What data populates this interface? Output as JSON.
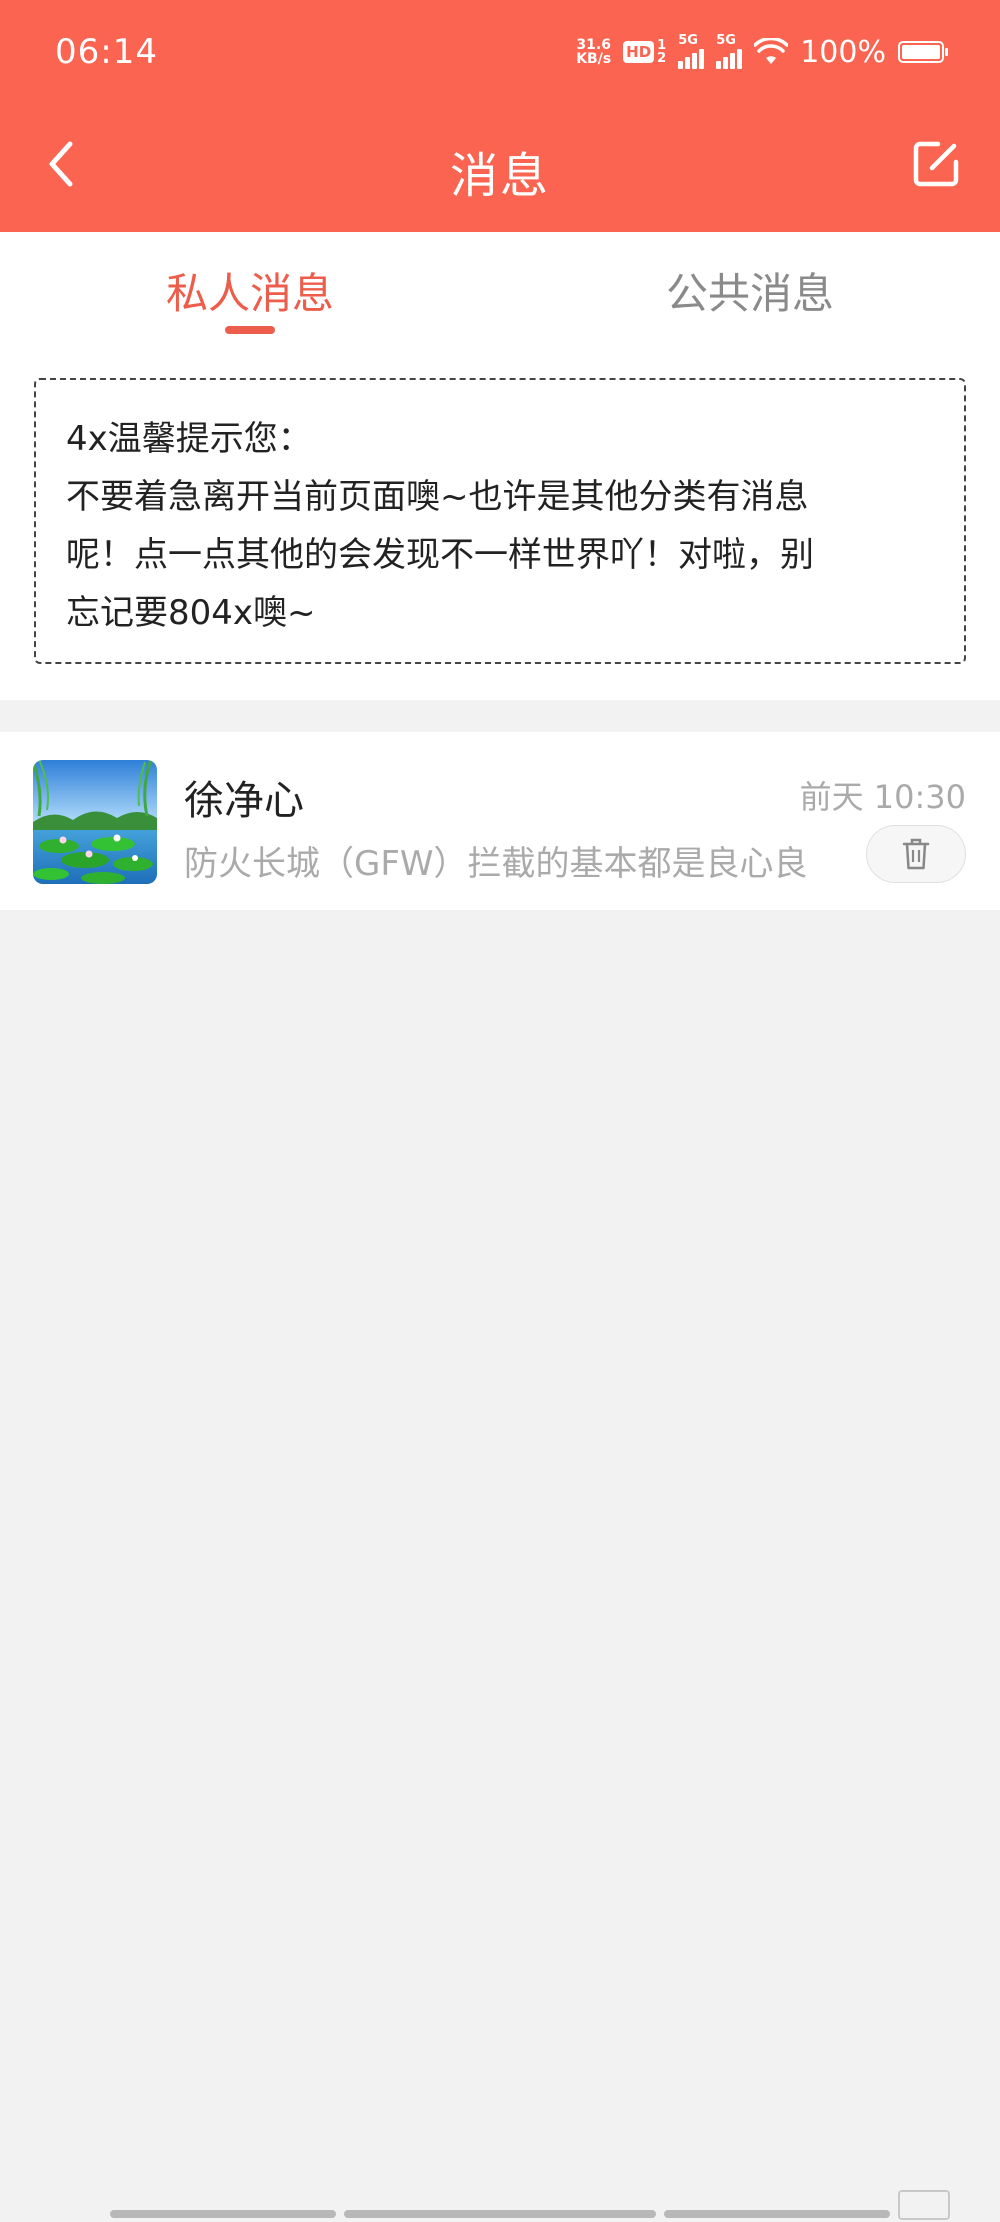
{
  "status_bar": {
    "time": "06:14",
    "net_speed_value": "31.6",
    "net_speed_unit": "KB/s",
    "hd_label": "HD",
    "hd_sub_top": "1",
    "hd_sub_bottom": "2",
    "signal1_label": "5G",
    "signal2_label": "5G",
    "battery_percent": "100%",
    "battery_level": 1.0
  },
  "header": {
    "title": "消息",
    "back_icon": "chevron-left-icon",
    "compose_icon": "compose-icon"
  },
  "tabs": [
    {
      "label": "私人消息",
      "active": true
    },
    {
      "label": "公共消息",
      "active": false
    }
  ],
  "tip": {
    "line1": "4x温馨提示您：",
    "line2": "不要着急离开当前页面噢~也许是其他分类有消息",
    "line3": "呢！点一点其他的会发现不一样世界吖！对啦，别",
    "line4": "忘记要804x噢~"
  },
  "messages": [
    {
      "sender": "徐净心",
      "time": "前天 10:30",
      "preview": "防火长城（GFW）拦截的基本都是良心良",
      "delete_icon": "trash-icon"
    }
  ],
  "colors": {
    "brand": "#fa6451",
    "active_tab": "#ec5e4b",
    "muted_text": "#aaaaaa"
  }
}
